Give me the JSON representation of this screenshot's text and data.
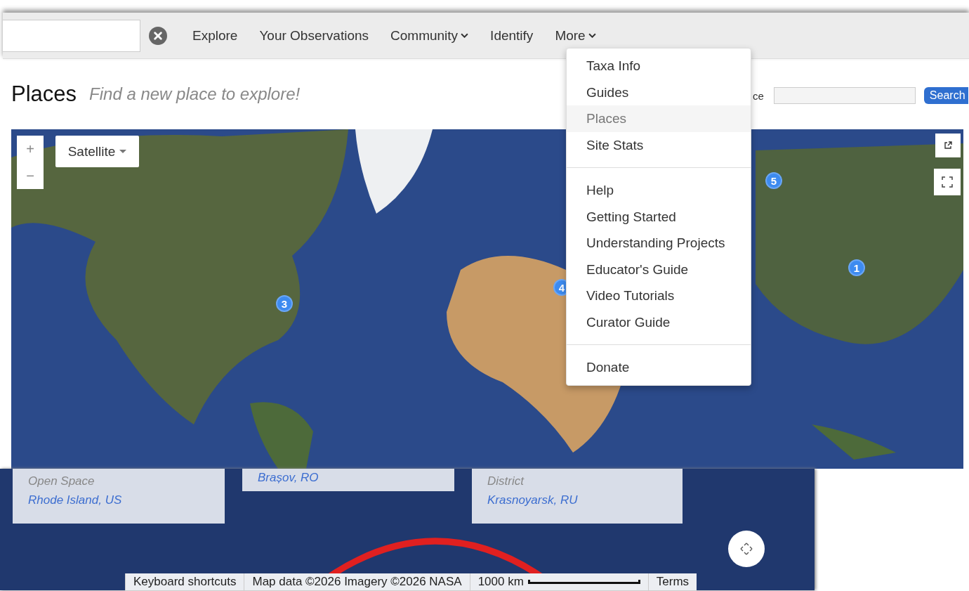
{
  "nav": {
    "items": [
      {
        "label": "Explore",
        "dropdown": false
      },
      {
        "label": "Your Observations",
        "dropdown": false
      },
      {
        "label": "Community",
        "dropdown": true
      },
      {
        "label": "Identify",
        "dropdown": false
      },
      {
        "label": "More",
        "dropdown": true
      }
    ]
  },
  "header": {
    "title": "Places",
    "subtitle": "Find a new place to explore!"
  },
  "place_search": {
    "label": "ce",
    "button": "Search"
  },
  "map": {
    "type_control": "Satellite",
    "zoom_in": "+",
    "zoom_out": "−",
    "markers": [
      {
        "count": "3"
      },
      {
        "count": "4"
      },
      {
        "count": "5"
      },
      {
        "count": "1"
      }
    ]
  },
  "menu": {
    "sections": [
      {
        "items": [
          {
            "label": "Taxa Info",
            "highlighted": false
          },
          {
            "label": "Guides",
            "highlighted": false
          },
          {
            "label": "Places",
            "highlighted": true
          },
          {
            "label": "Site Stats",
            "highlighted": false
          }
        ]
      },
      {
        "items": [
          {
            "label": "Help",
            "highlighted": false
          },
          {
            "label": "Getting Started",
            "highlighted": false
          },
          {
            "label": "Understanding Projects",
            "highlighted": false
          },
          {
            "label": "Educator's Guide",
            "highlighted": false
          },
          {
            "label": "Video Tutorials",
            "highlighted": false
          },
          {
            "label": "Curator Guide",
            "highlighted": false
          }
        ]
      },
      {
        "items": [
          {
            "label": "Donate",
            "highlighted": false
          }
        ]
      }
    ]
  },
  "lower": {
    "cards": [
      {
        "type": "Open Space",
        "place": "Rhode Island, US"
      },
      {
        "place": "Brașov, RO"
      },
      {
        "type": "District",
        "place": "Krasnoyarsk, RU"
      }
    ],
    "attribution": {
      "shortcuts": "Keyboard shortcuts",
      "data": "Map data ©2026 Imagery ©2026 NASA",
      "scale": "1000 km",
      "terms": "Terms"
    }
  }
}
